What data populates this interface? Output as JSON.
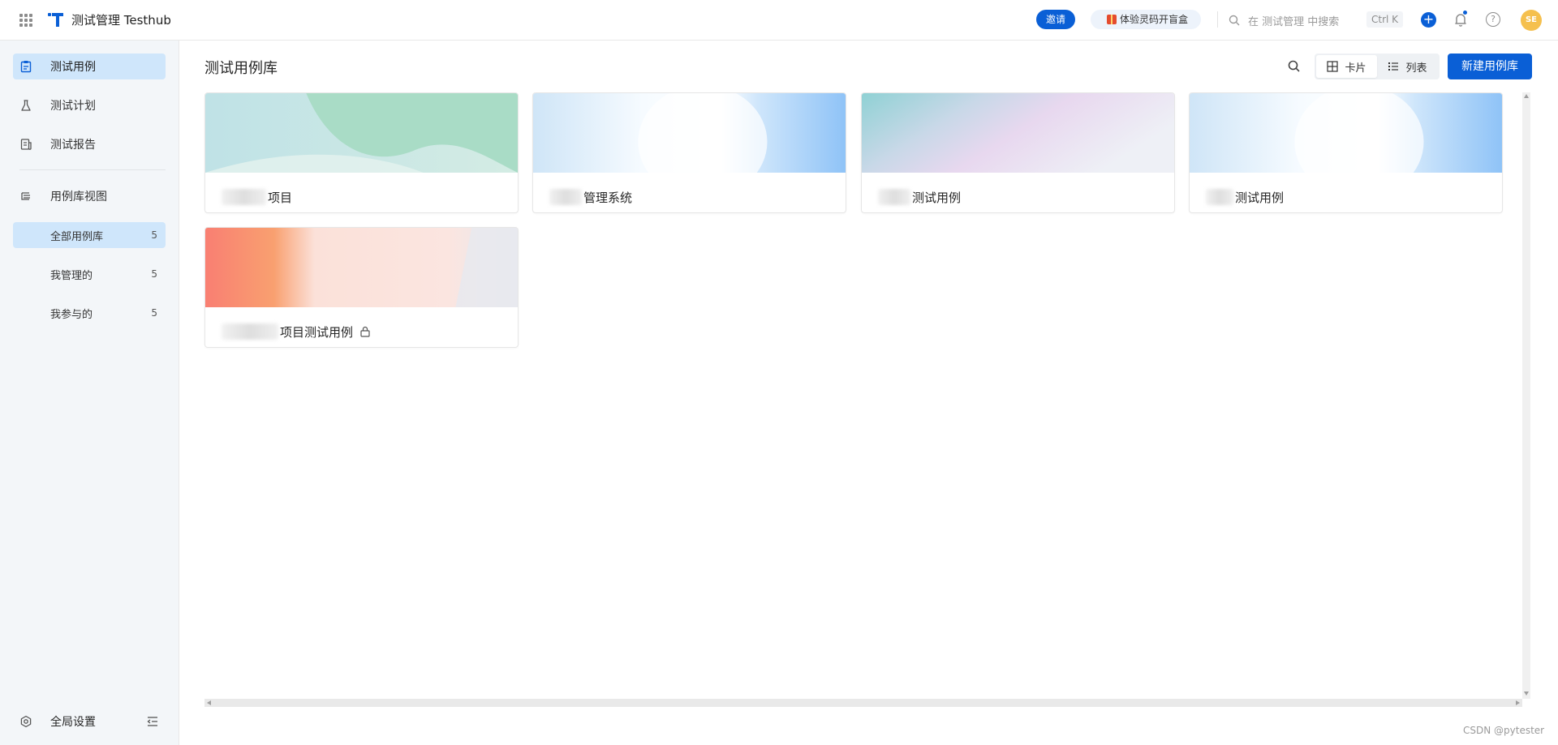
{
  "header": {
    "app_title": "测试管理 Testhub",
    "invite_label": "邀请",
    "promo_label": "体验灵码开盲盒",
    "search_placeholder": "在 测试管理 中搜索",
    "search_shortcut": "Ctrl K",
    "avatar_initials": "SE",
    "brand_color": "#0a5fd6"
  },
  "sidebar": {
    "nav_items": [
      {
        "label": "测试用例",
        "icon": "test-case-icon",
        "active": true
      },
      {
        "label": "测试计划",
        "icon": "flask-icon",
        "active": false
      },
      {
        "label": "测试报告",
        "icon": "report-icon",
        "active": false
      }
    ],
    "library_view": {
      "label": "用例库视图",
      "icon": "library-view-icon"
    },
    "sub_items": [
      {
        "label": "全部用例库",
        "count": "5",
        "active": true
      },
      {
        "label": "我管理的",
        "count": "5",
        "active": false
      },
      {
        "label": "我参与的",
        "count": "5",
        "active": false
      }
    ],
    "footer": {
      "label": "全局设置",
      "icon": "settings-icon"
    }
  },
  "main": {
    "title": "测试用例库",
    "view_options": [
      {
        "label": "卡片",
        "icon": "grid-icon",
        "active": true
      },
      {
        "label": "列表",
        "icon": "list-icon",
        "active": false
      }
    ],
    "new_button_label": "新建用例库",
    "cards": [
      {
        "name": "项目",
        "locked": false
      },
      {
        "name": "管理系统",
        "locked": false
      },
      {
        "name": "测试用例",
        "locked": false
      },
      {
        "name": "测试用例",
        "locked": false
      },
      {
        "name": "项目测试用例",
        "locked": true
      }
    ]
  },
  "watermark": "CSDN @pytester"
}
